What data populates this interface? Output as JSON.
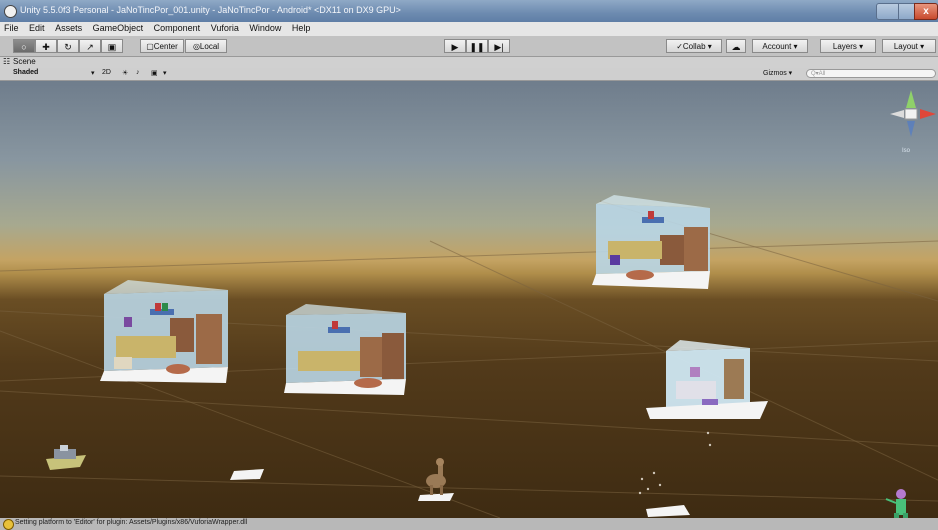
{
  "window": {
    "title": "Unity 5.5.0f3 Personal - JaNoTincPor_001.unity - JaNoTincPor - Android* <DX11 on DX9 GPU>",
    "close_glyph": "x"
  },
  "menu": [
    "File",
    "Edit",
    "Assets",
    "GameObject",
    "Component",
    "Vuforia",
    "Window",
    "Help"
  ],
  "toolbar": {
    "center_label": "Center",
    "local_label": "Local",
    "collab_label": "Collab ▾",
    "account_label": "Account ▾",
    "layers_label": "Layers ▾",
    "layout_label": "Layout ▾"
  },
  "scene": {
    "tab_label": "Scene",
    "shading_mode": "Shaded",
    "mode_2d": "2D",
    "gizmos_label": "Gizmos ▾",
    "search_placeholder": "Q▾All",
    "projection_label": "Iso"
  },
  "status": {
    "message": "Setting platform to 'Editor' for plugin: Assets/Plugins/x86/VuforiaWrapper.dll"
  },
  "colors": {
    "sky_top": "#6f7d8c",
    "horizon": "#c4a363",
    "ground": "#523a1a",
    "room_wall": "#b9d6e6",
    "room_floor_pad": "#f4f4f4",
    "gizmo_y": "#8fd16a",
    "gizmo_x": "#e0473a",
    "gizmo_z": "#4a7ad0"
  }
}
